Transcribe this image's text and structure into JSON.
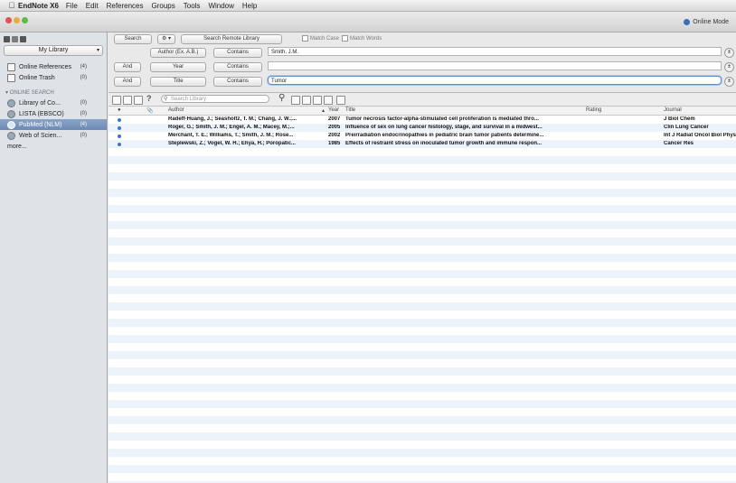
{
  "menubar": {
    "app_name": "EndNote X6",
    "items": [
      "File",
      "Edit",
      "References",
      "Groups",
      "Tools",
      "Window",
      "Help"
    ]
  },
  "toolbar": {
    "online_mode_label": "Online Mode"
  },
  "sidebar": {
    "library_select": "My Library",
    "items": [
      {
        "label": "Online References",
        "count": "(4)"
      },
      {
        "label": "Online Trash",
        "count": "(0)"
      }
    ],
    "online_search_header": "ONLINE SEARCH",
    "online_items": [
      {
        "label": "Library of Co...",
        "count": "(0)"
      },
      {
        "label": "LISTA (EBSCO)",
        "count": "(0)"
      },
      {
        "label": "PubMed (NLM)",
        "count": "(4)"
      },
      {
        "label": "Web of Scien...",
        "count": "(0)"
      }
    ],
    "more_label": "more..."
  },
  "search": {
    "search_button": "Search",
    "options_button": "⚙ ▾",
    "scope_select": "Search Remote Library",
    "match_case": "Match Case",
    "match_words": "Match Words",
    "rows": [
      {
        "bool": "",
        "field": "Author (Ex. A.B.)",
        "op": "Contains",
        "value": "Smith, J.M."
      },
      {
        "bool": "And",
        "field": "Year",
        "op": "Contains",
        "value": ""
      },
      {
        "bool": "And",
        "field": "Title",
        "op": "Contains",
        "value": "Tumor"
      }
    ]
  },
  "list_toolbar": {
    "quick_search_placeholder": "Search Library"
  },
  "table": {
    "headers": {
      "author": "Author",
      "year": "Year",
      "title": "Title",
      "rating": "Rating",
      "journal": "Journal"
    },
    "rows": [
      {
        "author": "Radeff-Huang, J.; Seasholtz, T. M.; Chang, J. W.;...",
        "year": "2007",
        "title": "Tumor necrosis factor-alpha-stimulated cell proliferation is mediated thro...",
        "journal": "J Biol Chem"
      },
      {
        "author": "Roger, G.; Smith, J. M.; Engel, A. M.; Macey, M.;...",
        "year": "2005",
        "title": "Influence of sex on lung cancer histology, stage, and survival in a midwest...",
        "journal": "Clin Lung Cancer"
      },
      {
        "author": "Merchant, T. E.; Williams, T.; Smith, J. M.; Rose...",
        "year": "2002",
        "title": "Preirradiation endocrinopathies in pediatric brain tumor patients determine...",
        "journal": "Int J Radiat Oncol Biol Phys"
      },
      {
        "author": "Steplewski, Z.; Vogel, W. H.; Ehya, H.; Poropatic...",
        "year": "1985",
        "title": "Effects of restraint stress on inoculated tumor growth and immune respon...",
        "journal": "Cancer Res"
      }
    ]
  }
}
